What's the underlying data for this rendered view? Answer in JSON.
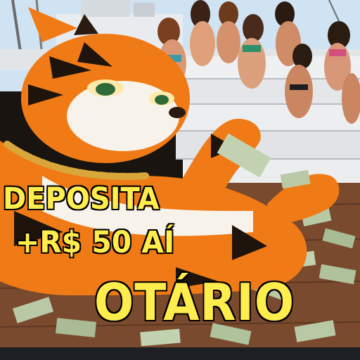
{
  "meme": {
    "caption_lines": [
      "DEPOSITA",
      "+R$ 50 AÍ",
      "OTÁRIO"
    ]
  },
  "colors": {
    "caption_fill": "#ffec4d",
    "caption_outline": "#141008",
    "tiger_orange": "#f07a16",
    "sky": "#cfe3f2",
    "deck_wood": "#7a4a2e",
    "cash_green": "#b9c9a6",
    "gold_chain": "#d9a63a"
  },
  "icons": [
    "tiger-character",
    "gold-chain",
    "cash-stack",
    "yacht",
    "sunbathing-crowd"
  ]
}
